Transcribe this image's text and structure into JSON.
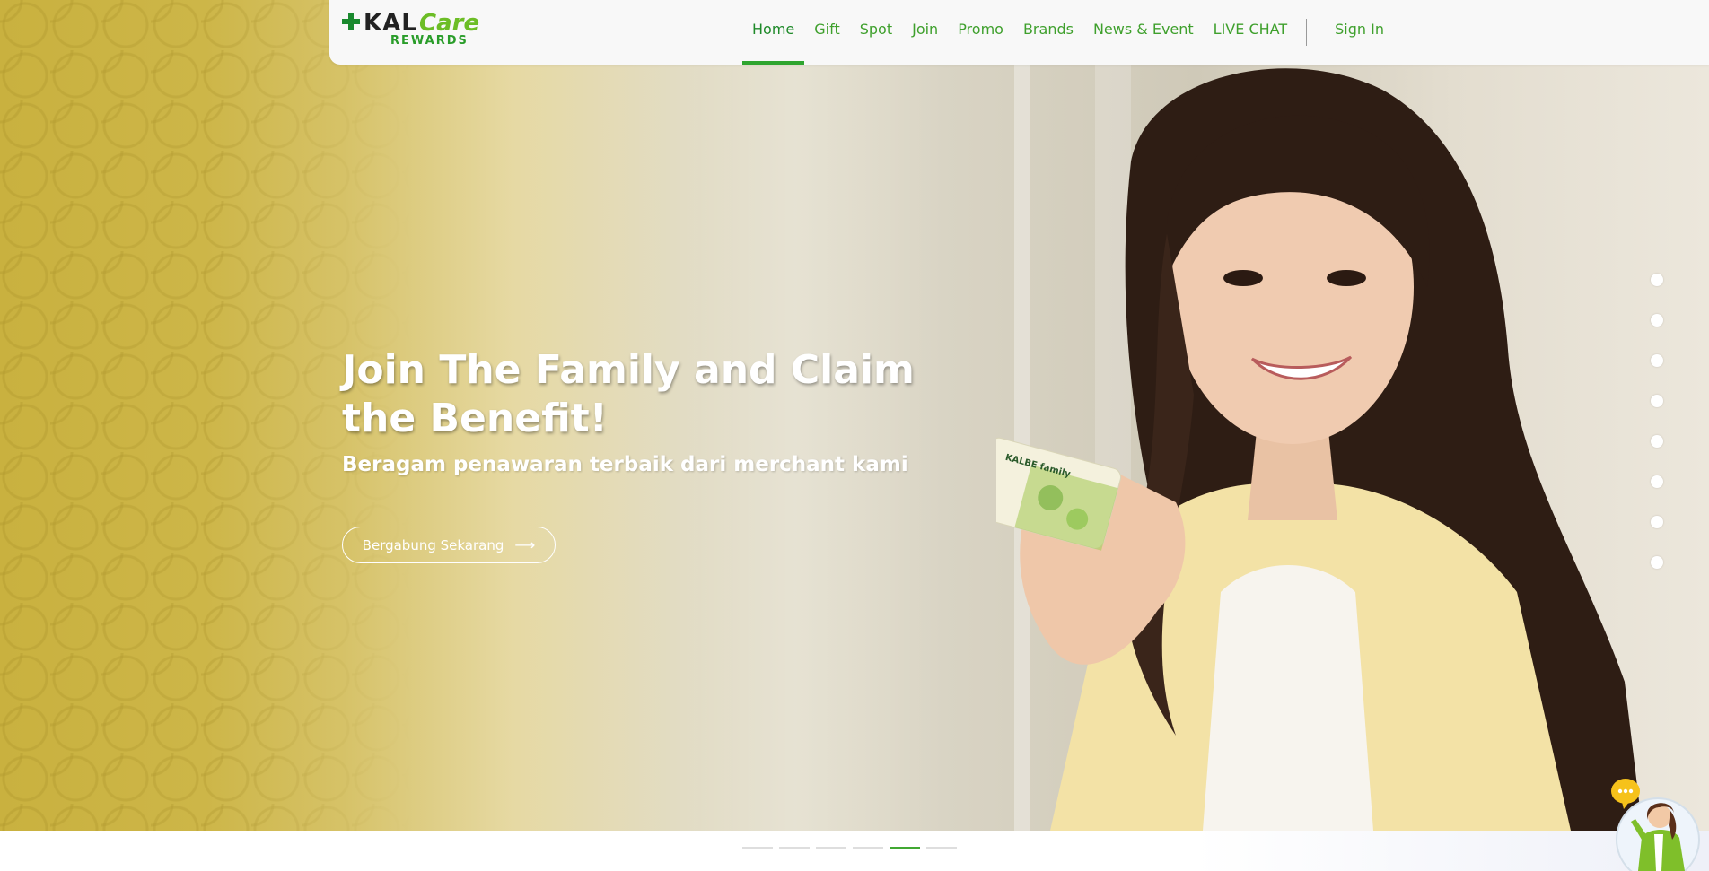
{
  "brand": {
    "logo_kal": "KAL",
    "logo_care": "Care",
    "logo_rewards": "REWARDS"
  },
  "nav": {
    "items": [
      {
        "label": "Home",
        "active": true
      },
      {
        "label": "Gift"
      },
      {
        "label": "Spot"
      },
      {
        "label": "Join"
      },
      {
        "label": "Promo"
      },
      {
        "label": "Brands"
      },
      {
        "label": "News & Event"
      },
      {
        "label": "LIVE CHAT"
      }
    ],
    "signin_label": "Sign In"
  },
  "hero": {
    "title": "Join The Family and Claim the Benefit!",
    "subtitle": "Beragam penawaran terbaik dari merchant kami",
    "cta_label": "Bergabung Sekarang",
    "cta_icon": "arrow-right-icon",
    "card_text": "KALBE family"
  },
  "slider": {
    "vertical_dot_count": 8,
    "bar_count": 6,
    "active_bar_index": 4
  },
  "colors": {
    "primary_green": "#3fa02d",
    "active_green": "#2fa52f",
    "brand_light_green": "#6cbd25",
    "hero_gold": "#c9b13f"
  }
}
